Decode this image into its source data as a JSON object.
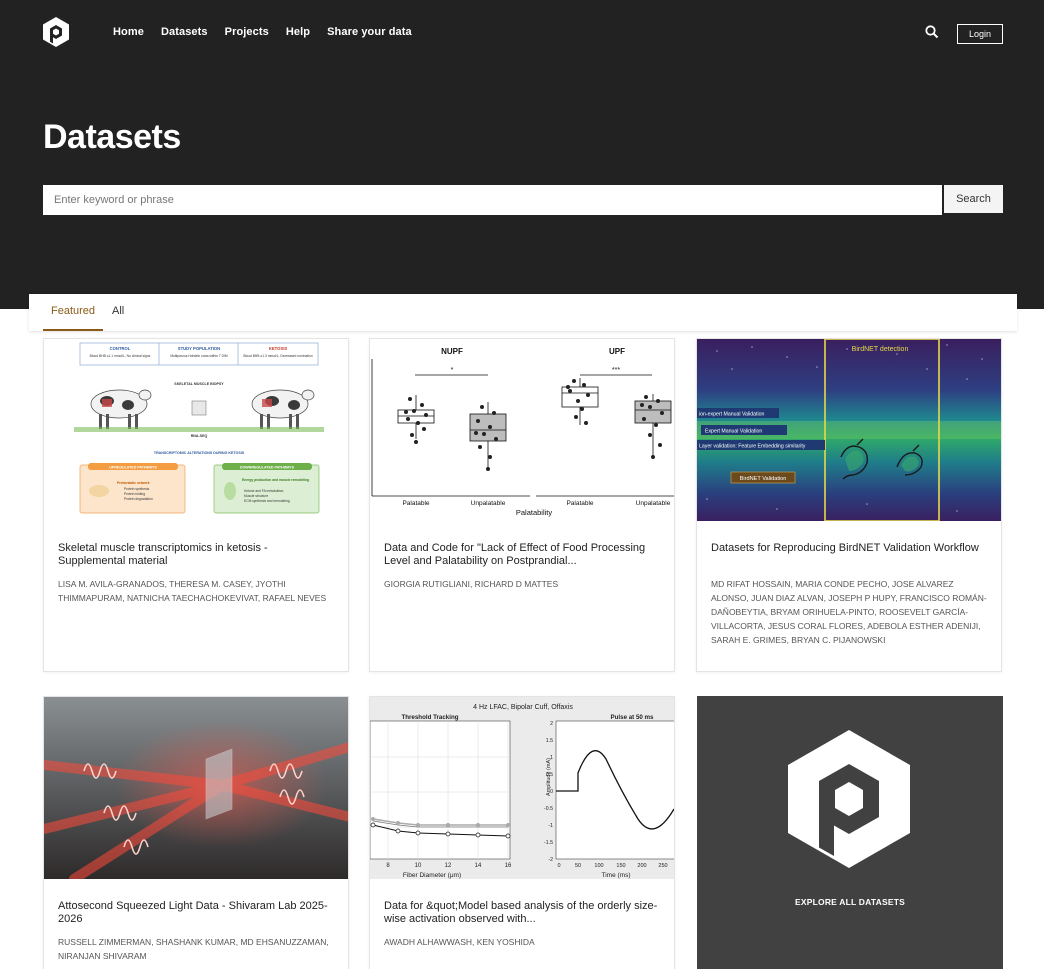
{
  "header": {
    "nav": [
      "Home",
      "Datasets",
      "Projects",
      "Help",
      "Share your data"
    ],
    "login_label": "Login",
    "logo_icon": "repository-logo-icon",
    "search_icon": "search-icon"
  },
  "hero": {
    "title": "Datasets",
    "search_placeholder": "Enter keyword or phrase",
    "search_button": "Search"
  },
  "tabs": [
    "Featured",
    "All"
  ],
  "cards": [
    {
      "title": "Skeletal muscle transcriptomics in ketosis - Supplemental material",
      "authors": "LISA M. AVILA-GRANADOS, THERESA M. CASEY, JYOTHI THIMMAPURAM, NATNICHA TAECHACHOKEVIVAT, RAFAEL NEVES",
      "figure": {
        "control_title": "CONTROL",
        "control_text": "Blood BHB ≤1.1 mmol/L, No clinical signs",
        "population_title": "STUDY POPULATION",
        "population_text": "Multiparous Holstein cows within 7 DIM",
        "ketosis_title": "KETOSIS",
        "ketosis_text": "Blood BHB ≥1.3 mmol/L, Decreased rumination",
        "biopsy": "SKELETAL MUSCLE BIOPSY",
        "rnaseq": "RNA-SEQ",
        "alterations": "TRANSCRIPTOMIC ALTERATIONS DURING KETOSIS",
        "up_title": "UPREGULATED PATHWAYS",
        "up_items": [
          "Proteostatic network",
          "Protein synthesis",
          "Protein folding",
          "Protein degradation"
        ],
        "down_title": "DOWNREGULATED PATHWAYS",
        "down_items": [
          "Energy production and muscle remodeling",
          "Ketone and FA metabolism",
          "Muscle structure",
          "ECM synthesis and remodeling"
        ]
      }
    },
    {
      "title": "Data and Code for \"Lack of Effect of Food Processing Level and Palatability on Postprandial...",
      "authors": "GIORGIA RUTIGLIANI, RICHARD D MATTES",
      "figure": {
        "panel_left": "NUPF",
        "panel_right": "UPF",
        "sig_left": "*",
        "sig_right": "***",
        "x_ticks": [
          "Palatable",
          "Unpalatable",
          "Palatable",
          "Unpalatable"
        ],
        "xlabel": "Palatability"
      }
    },
    {
      "title": "Datasets for Reproducing BirdNET Validation Workflow",
      "authors": "MD RIFAT HOSSAIN, MARIA CONDE PECHO, JOSE ALVAREZ ALONSO, JUAN DIAZ ALVAN, JOSEPH P HUPY, FRANCISCO ROMÁN-DAÑOBEYTIA, BRYAM ORIHUELA-PINTO, ROOSEVELT GARCÍA-VILLACORTA, JESUS CORAL FLORES, ADEBOLA ESTHER ADENIJI, SARAH E. GRIMES, BRYAN C. PIJANOWSKI",
      "figure": {
        "detection": "BirdNET detection",
        "labels": [
          "ion-expert Manual Validation",
          "Expert Manual Validation",
          "Layer validation: Feature Embedding similarity",
          "BirdNET Validation"
        ]
      }
    },
    {
      "title": "Attosecond Squeezed Light Data - Shivaram Lab 2025-2026",
      "authors": "RUSSELL ZIMMERMAN, SHASHANK KUMAR, MD EHSANUZZAMAN, NIRANJAN SHIVARAM"
    },
    {
      "title": "Data for &quot;Model based analysis of the orderly size-wise activation observed with...",
      "authors": "AWADH ALHAWWASH, KEN YOSHIDA",
      "figure": {
        "suptitle": "4 Hz LFAC, Bipolar Cuff, Offaxis",
        "left_title": "Threshold Tracking",
        "left_xlabel": "Fiber Diameter (μm)",
        "left_xticks": [
          "8",
          "10",
          "12",
          "14",
          "16"
        ],
        "right_title": "Pulse at 50 ms",
        "right_ylabel": "Amplitude (mA)",
        "right_xlabel": "Time (ms)",
        "right_xticks": [
          "0",
          "50",
          "100",
          "150",
          "200",
          "250"
        ],
        "right_yticks": [
          "2",
          "1.5",
          "1",
          "0.5",
          "0",
          "-0.5",
          "-1",
          "-1.5",
          "-2"
        ]
      }
    }
  ],
  "explore": {
    "label": "EXPLORE ALL DATASETS"
  }
}
